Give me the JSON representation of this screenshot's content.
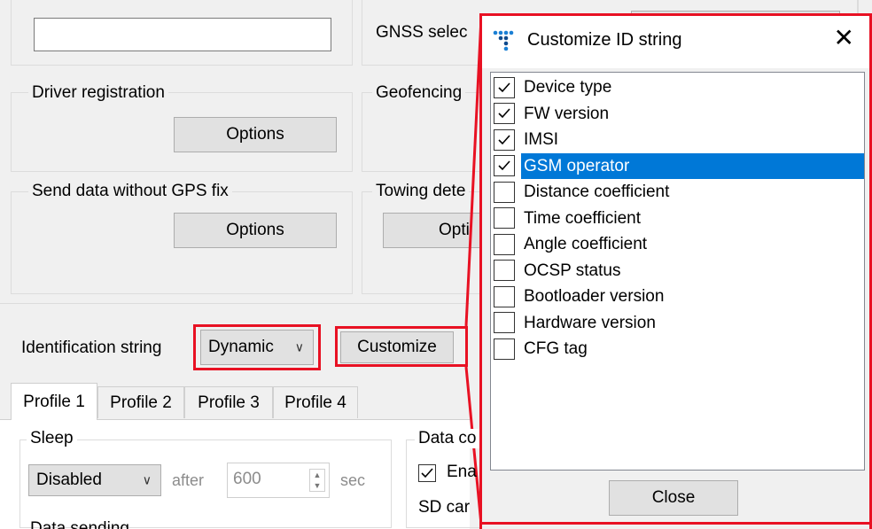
{
  "main": {
    "gnss_label": "GNSS selec",
    "driver_registration": {
      "title": "Driver registration",
      "button": "Options"
    },
    "geofencing": {
      "title": "Geofencing"
    },
    "send_without_gps": {
      "title": "Send data without GPS fix",
      "button": "Options"
    },
    "towing": {
      "title": "Towing dete",
      "button": "Opti"
    },
    "identification": {
      "label": "Identification string",
      "selected": "Dynamic",
      "customize_label": "Customize"
    }
  },
  "tabs": [
    {
      "label": "Profile 1",
      "active": true
    },
    {
      "label": "Profile 2",
      "active": false
    },
    {
      "label": "Profile 3",
      "active": false
    },
    {
      "label": "Profile 4",
      "active": false
    }
  ],
  "profile": {
    "sleep": {
      "title": "Sleep",
      "mode": "Disabled",
      "after_label": "after",
      "value": "600",
      "unit": "sec"
    },
    "data_group": {
      "title": "Data co",
      "enable_label": "Ena",
      "sd_label": "SD car"
    },
    "data_sending_title": "Data sending"
  },
  "dialog": {
    "title": "Customize ID string",
    "close_label": "Close",
    "items": [
      {
        "label": "Device type",
        "checked": true,
        "selected": false
      },
      {
        "label": "FW version",
        "checked": true,
        "selected": false
      },
      {
        "label": "IMSI",
        "checked": true,
        "selected": false
      },
      {
        "label": "GSM operator",
        "checked": true,
        "selected": true
      },
      {
        "label": "Distance coefficient",
        "checked": false,
        "selected": false
      },
      {
        "label": "Time coefficient",
        "checked": false,
        "selected": false
      },
      {
        "label": "Angle coefficient",
        "checked": false,
        "selected": false
      },
      {
        "label": "OCSP status",
        "checked": false,
        "selected": false
      },
      {
        "label": "Bootloader version",
        "checked": false,
        "selected": false
      },
      {
        "label": "Hardware version",
        "checked": false,
        "selected": false
      },
      {
        "label": "CFG tag",
        "checked": false,
        "selected": false
      }
    ]
  },
  "colors": {
    "highlight": "#0078d7",
    "annotation_red": "#e81123",
    "logo_blue": "#1a7fd4"
  }
}
